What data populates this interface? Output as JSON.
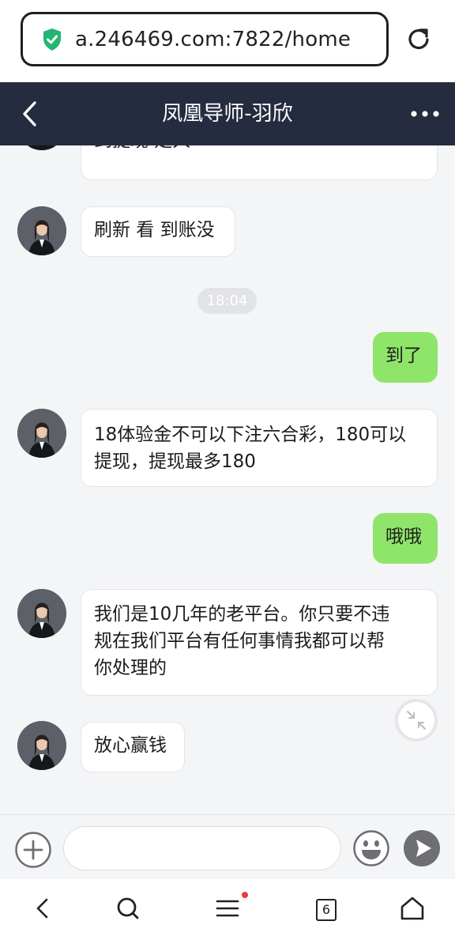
{
  "browser": {
    "url": "a.246469.com:7822/home",
    "secure_icon": "shield-check-icon",
    "reload_icon": "reload-icon"
  },
  "header": {
    "title": "凤凰导师-羽欣",
    "back_icon": "chevron-left-icon",
    "more_icon": "more-dots-icon",
    "background": "#262c3f"
  },
  "messages": [
    {
      "sender": "other",
      "text": "到提现 走人"
    },
    {
      "sender": "other",
      "text": "刷新 看 到账没"
    },
    {
      "type": "time",
      "text": "18:04"
    },
    {
      "sender": "me",
      "text": "到了"
    },
    {
      "sender": "other",
      "line1": "18体验金不可以下注六合彩，180可以",
      "line2": "提现，提现最多180"
    },
    {
      "sender": "me",
      "text": "哦哦"
    },
    {
      "sender": "other",
      "line1": "我们是10几年的老平台。你只要不违",
      "line2": "规在我们平台有任何事情我都可以帮",
      "line3": "你处理的"
    },
    {
      "sender": "other",
      "text": "放心赢钱"
    }
  ],
  "colors": {
    "my_bubble": "#8fe56a",
    "their_bubble": "#ffffff",
    "chat_background": "#f4f5f7"
  },
  "input": {
    "placeholder": "",
    "plus_icon": "plus-circle-icon",
    "emoji_icon": "emoji-icon",
    "send_icon": "send-icon"
  },
  "bottom_nav": {
    "tabs_count": "6",
    "items": [
      "back-icon",
      "search-icon",
      "menu-icon",
      "tabs-icon",
      "home-icon"
    ]
  }
}
